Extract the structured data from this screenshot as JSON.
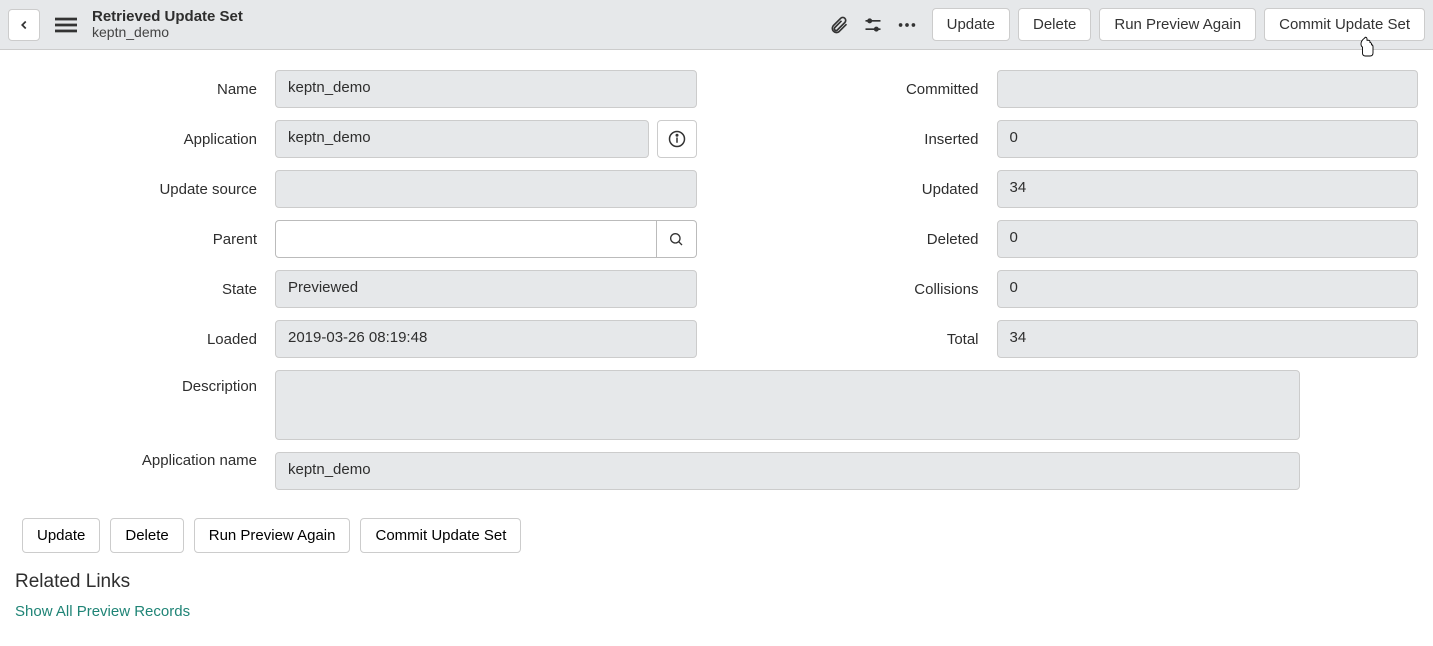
{
  "header": {
    "title": "Retrieved Update Set",
    "subtitle": "keptn_demo",
    "buttons": {
      "update": "Update",
      "delete": "Delete",
      "run_preview": "Run Preview Again",
      "commit": "Commit Update Set"
    }
  },
  "form": {
    "left": {
      "name_label": "Name",
      "name_value": "keptn_demo",
      "application_label": "Application",
      "application_value": "keptn_demo",
      "update_source_label": "Update source",
      "update_source_value": "",
      "parent_label": "Parent",
      "parent_value": "",
      "state_label": "State",
      "state_value": "Previewed",
      "loaded_label": "Loaded",
      "loaded_value": "2019-03-26 08:19:48"
    },
    "right": {
      "committed_label": "Committed",
      "committed_value": "",
      "inserted_label": "Inserted",
      "inserted_value": "0",
      "updated_label": "Updated",
      "updated_value": "34",
      "deleted_label": "Deleted",
      "deleted_value": "0",
      "collisions_label": "Collisions",
      "collisions_value": "0",
      "total_label": "Total",
      "total_value": "34"
    },
    "description_label": "Description",
    "description_value": "",
    "appname_label": "Application name",
    "appname_value": "keptn_demo"
  },
  "bottom_buttons": {
    "update": "Update",
    "delete": "Delete",
    "run_preview": "Run Preview Again",
    "commit": "Commit Update Set"
  },
  "related": {
    "heading": "Related Links",
    "link1": "Show All Preview Records"
  }
}
